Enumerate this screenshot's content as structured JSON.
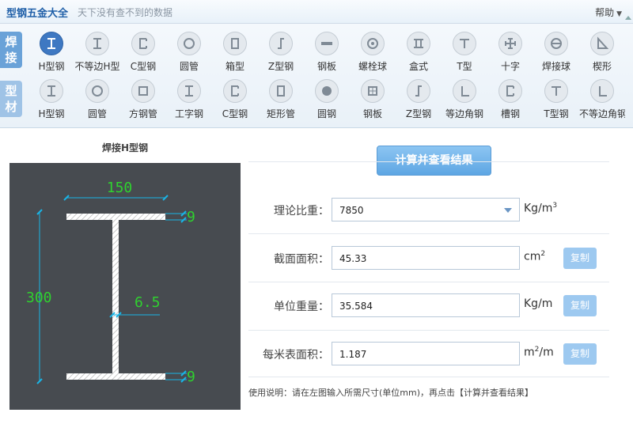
{
  "app": {
    "title": "型钢五金大全",
    "subtitle": "天下没有查不到的数据",
    "help_label": "帮助"
  },
  "categories": [
    {
      "chars": [
        "焊",
        "接"
      ],
      "active": true
    },
    {
      "chars": [
        "型",
        "材"
      ],
      "active": false
    }
  ],
  "toolbar": {
    "row1": [
      {
        "label": "H型钢",
        "icon": "h-beam-icon",
        "selected": true
      },
      {
        "label": "不等边H型",
        "icon": "unequal-h-icon"
      },
      {
        "label": "C型钢",
        "icon": "c-channel-icon"
      },
      {
        "label": "圆管",
        "icon": "round-tube-icon"
      },
      {
        "label": "箱型",
        "icon": "box-section-icon"
      },
      {
        "label": "Z型钢",
        "icon": "z-section-icon"
      },
      {
        "label": "钢板",
        "icon": "steel-plate-icon"
      },
      {
        "label": "螺栓球",
        "icon": "bolt-ball-icon"
      },
      {
        "label": "盒式",
        "icon": "box-type-icon"
      },
      {
        "label": "T型",
        "icon": "t-section-icon"
      },
      {
        "label": "十字",
        "icon": "cross-section-icon"
      },
      {
        "label": "焊接球",
        "icon": "welded-ball-icon"
      },
      {
        "label": "楔形",
        "icon": "wedge-icon"
      }
    ],
    "row2": [
      {
        "label": "H型钢",
        "icon": "h-beam-icon"
      },
      {
        "label": "圆管",
        "icon": "round-tube-icon"
      },
      {
        "label": "方钢管",
        "icon": "square-tube-icon"
      },
      {
        "label": "工字钢",
        "icon": "i-beam-icon"
      },
      {
        "label": "C型钢",
        "icon": "c-channel-icon"
      },
      {
        "label": "矩形管",
        "icon": "rect-tube-icon"
      },
      {
        "label": "圆钢",
        "icon": "round-bar-icon"
      },
      {
        "label": "钢板",
        "icon": "checker-plate-icon"
      },
      {
        "label": "Z型钢",
        "icon": "z-section-icon"
      },
      {
        "label": "等边角钢",
        "icon": "equal-angle-icon"
      },
      {
        "label": "槽钢",
        "icon": "channel-icon"
      },
      {
        "label": "T型钢",
        "icon": "t-section-icon"
      },
      {
        "label": "不等边角钢",
        "icon": "unequal-angle-icon"
      }
    ]
  },
  "drawing": {
    "title": "焊接H型钢",
    "dims": {
      "flange_width": "150",
      "height": "300",
      "web_thickness": "6.5",
      "top_flange": "9",
      "bottom_flange": "9"
    }
  },
  "calc_button": "计算并查看结果",
  "fields": [
    {
      "label": "理论比重：",
      "value": "7850",
      "unit": "Kg/m",
      "unit_sup": "3",
      "dropdown": true,
      "copy": false
    },
    {
      "label": "截面面积：",
      "value": "45.33",
      "unit": "cm",
      "unit_sup": "2",
      "dropdown": false,
      "copy": true
    },
    {
      "label": "单位重量：",
      "value": "35.584",
      "unit": "Kg/m",
      "unit_sup": "",
      "dropdown": false,
      "copy": true
    },
    {
      "label": "每米表面积：",
      "value": "1.187",
      "unit_pre": "m",
      "unit_pre_sup": "2",
      "unit": "/m",
      "unit_sup": "",
      "dropdown": false,
      "copy": true
    }
  ],
  "copy_label": "复制",
  "usage_text": "使用说明：请在左图输入所需尺寸(单位mm)，再点击【计算并查看结果】",
  "colors": {
    "accent": "#3e78c2",
    "dimension_green": "#2fd12f",
    "dimension_cyan": "#19b4e6",
    "canvas_bg": "#474b50"
  }
}
